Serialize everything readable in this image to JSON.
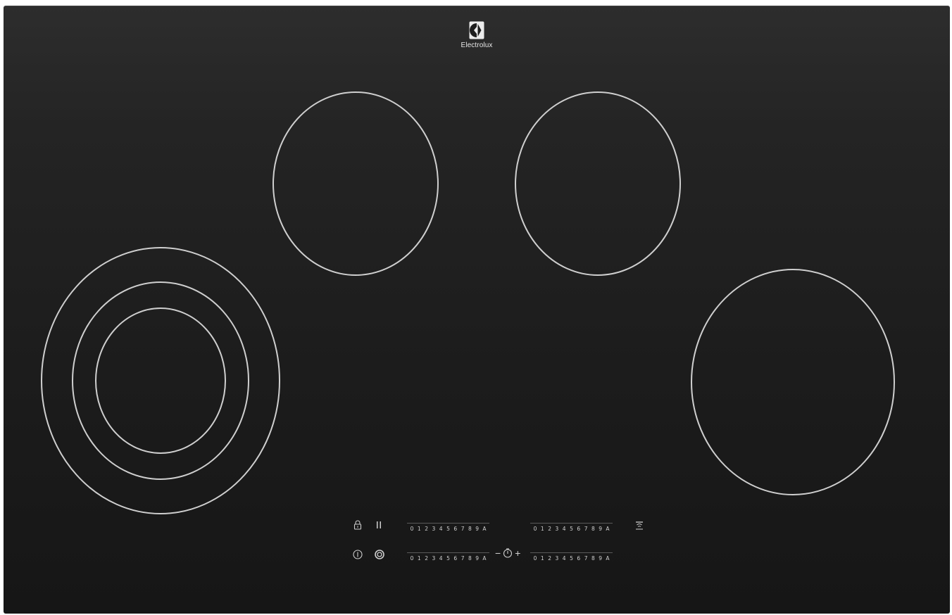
{
  "brand": {
    "name": "Electrolux",
    "icon": "electrolux-logo-icon"
  },
  "cooking_zones": [
    {
      "id": "rear-left",
      "rings": 1
    },
    {
      "id": "rear-right",
      "rings": 1
    },
    {
      "id": "front-left",
      "rings": 3
    },
    {
      "id": "front-right",
      "rings": 1
    }
  ],
  "controls": {
    "lock_icon": "lock-icon",
    "pause_icon": "pause-icon",
    "power_icon": "power-icon",
    "bridge_icon": "bridge-zone-icon",
    "hob2hood_icon": "hob2hood-icon",
    "timer": {
      "minus": "−",
      "plus": "+",
      "icon": "timer-icon"
    },
    "power_scales": [
      {
        "id": "rear-left",
        "levels": [
          "0",
          "1",
          "2",
          "3",
          "4",
          "5",
          "6",
          "7",
          "8",
          "9",
          "A"
        ]
      },
      {
        "id": "rear-right",
        "levels": [
          "0",
          "1",
          "2",
          "3",
          "4",
          "5",
          "6",
          "7",
          "8",
          "9",
          "A"
        ]
      },
      {
        "id": "front-left",
        "levels": [
          "0",
          "1",
          "2",
          "3",
          "4",
          "5",
          "6",
          "7",
          "8",
          "9",
          "A"
        ]
      },
      {
        "id": "front-right",
        "levels": [
          "0",
          "1",
          "2",
          "3",
          "4",
          "5",
          "6",
          "7",
          "8",
          "9",
          "A"
        ]
      }
    ]
  }
}
